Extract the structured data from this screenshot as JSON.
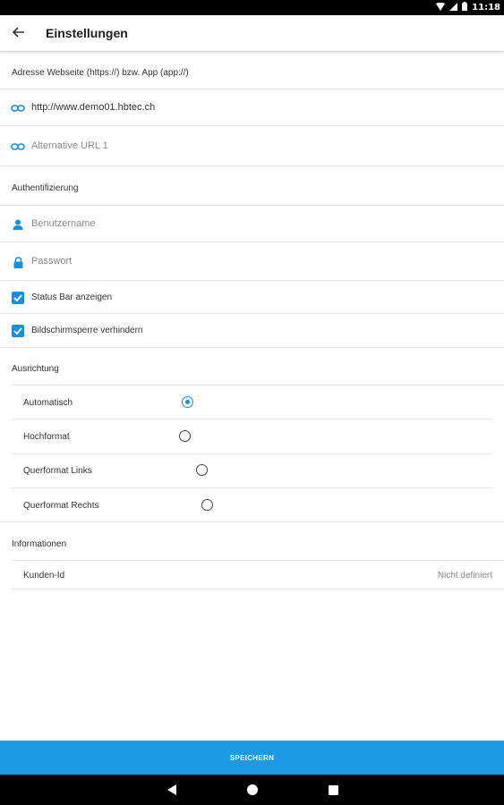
{
  "status_bar": {
    "time": "11:18"
  },
  "app_bar": {
    "title": "Einstellungen"
  },
  "sections": {
    "address": "Adresse Webseite (https://) bzw. App (app://)",
    "auth": "Authentifizierung",
    "orientation": "Ausrichtung",
    "info": "Informationen"
  },
  "address": {
    "url_value": "http://www.demo01.hbtec.ch",
    "alt_url_placeholder": "Alternative URL 1"
  },
  "auth": {
    "username_placeholder": "Benutzername",
    "password_placeholder": "Passwort"
  },
  "options": {
    "status_bar_label": "Status Bar anzeigen",
    "status_bar_checked": true,
    "screen_lock_label": "Bildschirmsperre verhindern",
    "screen_lock_checked": true
  },
  "orientation": {
    "options": [
      {
        "label": "Automatisch",
        "selected": true
      },
      {
        "label": "Hochformat",
        "selected": false
      },
      {
        "label": "Querformat Links",
        "selected": false
      },
      {
        "label": "Querformat Rechts",
        "selected": false
      }
    ]
  },
  "info": {
    "customer_id_label": "Kunden-Id",
    "customer_id_value": "Nicht definiert"
  },
  "save_button": {
    "label": "SPEICHERN"
  },
  "colors": {
    "accent": "#1a9ae5",
    "checkbox": "#1a8ee0",
    "link_icon": "#1a8ee0"
  }
}
